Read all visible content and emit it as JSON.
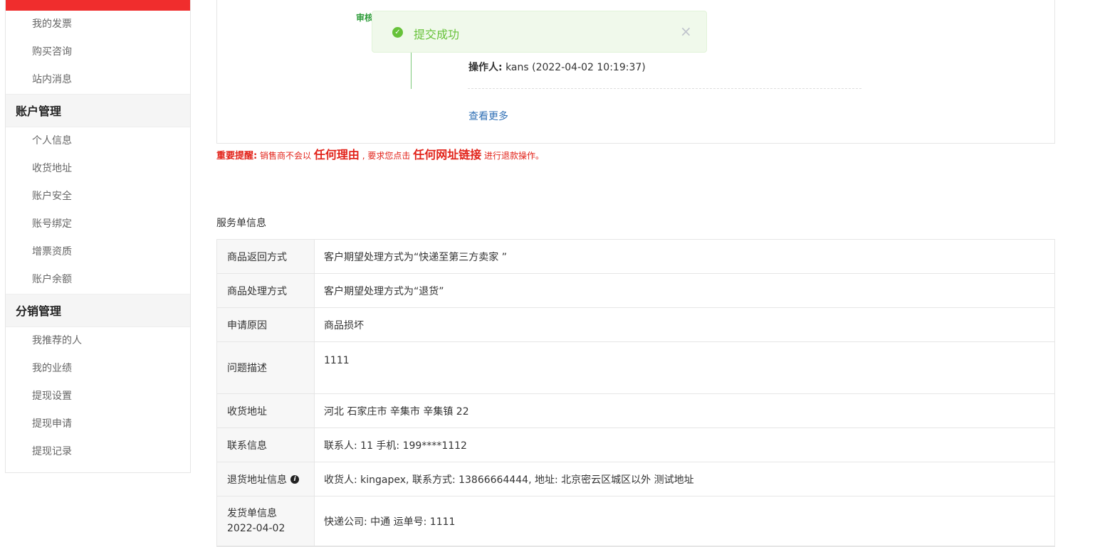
{
  "sidebar": {
    "group1_items": [
      "我的发票",
      "购买咨询",
      "站内消息"
    ],
    "group2_title": "账户管理",
    "group2_items": [
      "个人信息",
      "收货地址",
      "账户安全",
      "账号绑定",
      "增票资质",
      "账户余额"
    ],
    "group3_title": "分销管理",
    "group3_items": [
      "我推荐的人",
      "我的业绩",
      "提现设置",
      "提现申请",
      "提现记录"
    ]
  },
  "progress": {
    "audit_label": "审核",
    "operator_label": "操作人:",
    "operator_value": "kans (2022-04-02 10:19:37)",
    "more_link": "查看更多"
  },
  "toast": {
    "text": "提交成功",
    "close": "×"
  },
  "warning": {
    "label": "重要提醒:",
    "part1": "销售商不会以",
    "big1": "任何理由",
    "part2": ", 要求您点击",
    "big2": "任何网址链接",
    "part3": "进行退款操作。"
  },
  "service": {
    "title": "服务单信息",
    "rows": [
      {
        "label": "商品返回方式",
        "value": "客户期望处理方式为“快递至第三方卖家 ”"
      },
      {
        "label": "商品处理方式",
        "value": "客户期望处理方式为“退货”"
      },
      {
        "label": "申请原因",
        "value": "商品损坏"
      },
      {
        "label": "问题描述",
        "value": "1111"
      },
      {
        "label": "收货地址",
        "value": "河北 石家庄市 辛集市 辛集镇 22"
      },
      {
        "label": "联系信息",
        "value": "联系人: 11   手机: 199****1112"
      },
      {
        "label": "退货地址信息",
        "value": "收货人: kingapex, 联系方式: 13866664444, 地址: 北京密云区城区以外 测试地址"
      },
      {
        "label": "发货单信息",
        "label_date": "2022-04-02",
        "value": "快递公司: 中通   运单号: 1111"
      }
    ]
  },
  "colors": {
    "accent": "#f02d2d",
    "success": "#67c23a",
    "link": "#2f6fb5",
    "warning": "#e2231a"
  }
}
